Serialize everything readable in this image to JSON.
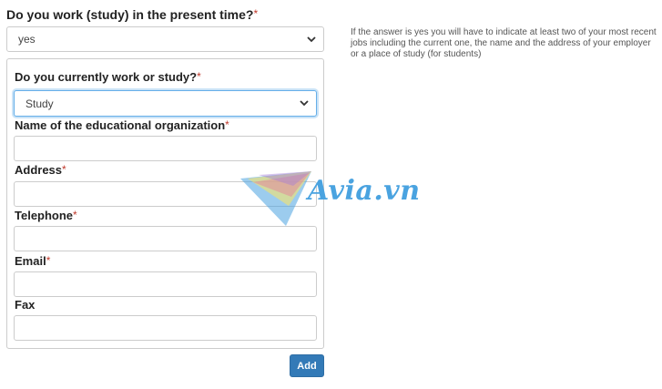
{
  "question": {
    "label": "Do you work (study) in the present time?",
    "required": "*"
  },
  "main_select": {
    "value": "yes"
  },
  "help_text": "If the answer is yes you will have to indicate at least two of your most recent jobs including the current one, the name and the address of your employer or a place of study (for students)",
  "panel": {
    "work_or_study_label": "Do you currently work or study?",
    "work_or_study_required": "*",
    "work_or_study_value": "Study",
    "fields": [
      {
        "label": "Name of the educational organization",
        "required": "*"
      },
      {
        "label": "Address",
        "required": "*"
      },
      {
        "label": "Telephone",
        "required": "*"
      },
      {
        "label": "Email",
        "required": "*"
      },
      {
        "label": "Fax",
        "required": ""
      }
    ]
  },
  "add_button": {
    "label": "Add"
  },
  "watermark": {
    "text": "Avia.vn"
  },
  "colors": {
    "accent": "#337ab7",
    "required": "#c0392b",
    "focus": "#66afe9"
  },
  "icons": {
    "select_arrow": "chevron-down-icon"
  }
}
